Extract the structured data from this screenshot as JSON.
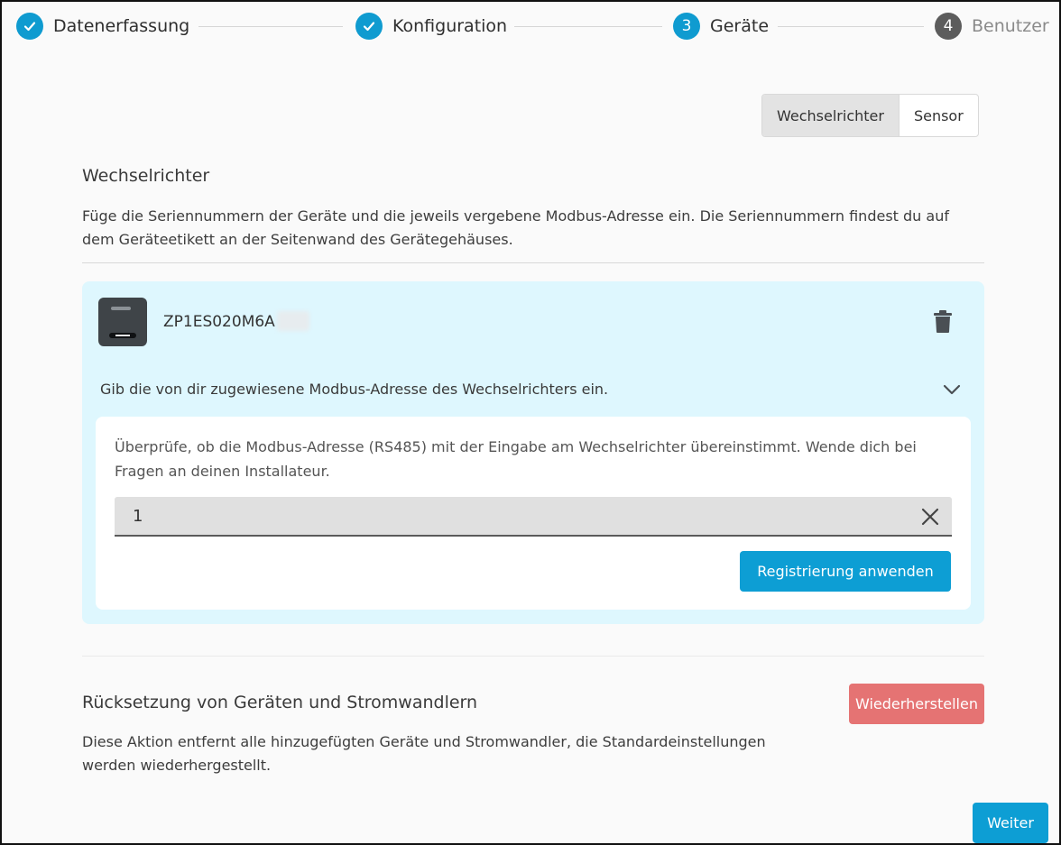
{
  "stepper": {
    "steps": [
      {
        "number": "",
        "label": "Datenerfassung",
        "state": "done"
      },
      {
        "number": "",
        "label": "Konfiguration",
        "state": "done"
      },
      {
        "number": "3",
        "label": "Geräte",
        "state": "active"
      },
      {
        "number": "4",
        "label": "Benutzer",
        "state": "pending"
      }
    ]
  },
  "device_type_toggle": {
    "options": [
      "Wechselrichter",
      "Sensor"
    ],
    "selected": "Wechselrichter"
  },
  "inverter_section": {
    "title": "Wechselrichter",
    "description": "Füge die Seriennummern der Geräte und die jeweils vergebene Modbus-Adresse ein. Die Seriennummern findest du auf dem Geräteetikett an der Seitenwand des Gerätegehäuses."
  },
  "device_card": {
    "serial_number": "ZP1ES020M6A",
    "modbus_prompt": "Gib die von dir zugewiesene Modbus-Adresse des Wechselrichters ein.",
    "hint": "Überprüfe, ob die Modbus-Adresse (RS485) mit der Eingabe am Wechselrichter übereinstimmt. Wende dich bei Fragen an deinen Installateur.",
    "modbus_address_value": "1",
    "apply_label": "Registrierung anwenden"
  },
  "reset_section": {
    "title": "Rücksetzung von Geräten und Stromwandlern",
    "description": "Diese Aktion entfernt alle hinzugefügten Geräte und Stromwandler, die Standardeinstellungen werden wiederhergestellt.",
    "button_label": "Wiederherstellen"
  },
  "footer": {
    "next_label": "Weiter"
  },
  "colors": {
    "primary": "#0d9ed4",
    "danger": "#e57373",
    "card_background": "#def7fe",
    "pending_step": "#5c5c5c"
  },
  "icons": {
    "done_step": "checkmark-icon",
    "delete": "trash-icon",
    "expand": "chevron-down-icon",
    "clear": "close-icon"
  }
}
